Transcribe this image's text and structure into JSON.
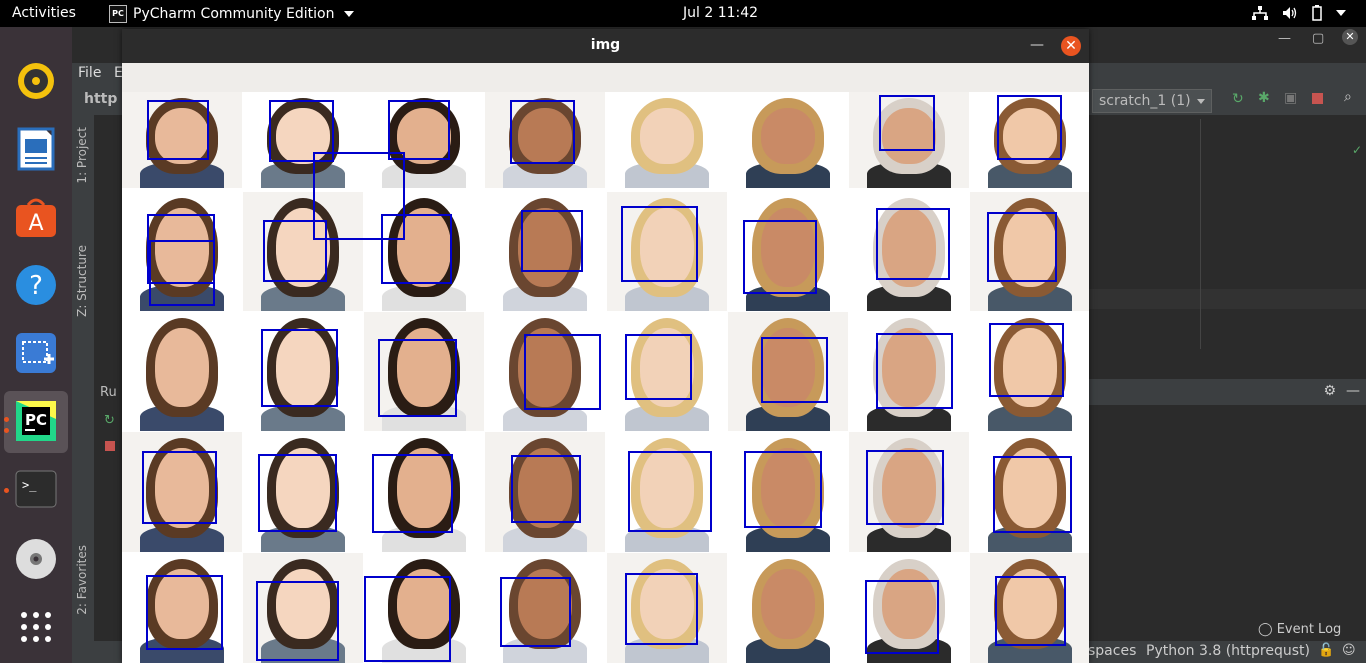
{
  "topbar": {
    "activities": "Activities",
    "app_name": "PyCharm Community Edition",
    "app_icon": "PC",
    "clock": "Jul 2  11:42"
  },
  "dock": {
    "items": [
      "rhythmbox-icon",
      "libreoffice-writer-icon",
      "ubuntu-software-icon",
      "help-icon",
      "screenshot-icon",
      "pycharm-icon",
      "terminal-icon",
      "dvd-icon",
      "app-grid-icon"
    ]
  },
  "ide": {
    "menu_file": "File",
    "menu_edit": "E",
    "project_fragment": "http",
    "run_config": "scratch_1 (1)",
    "left_tabs": {
      "project": "1: Project",
      "structure": "Z: Structure",
      "favorites": "2: Favorites"
    },
    "run_label": "Ru",
    "event_log": "Event Log",
    "status_spaces": "spaces",
    "status_interpreter": "Python 3.8 (httprequst)"
  },
  "imgwin": {
    "title": "img",
    "minimize": "—",
    "close": "✕"
  },
  "colors": {
    "box": "#0000cc",
    "ubuntu_orange": "#e95420"
  },
  "grid": {
    "rows": 5,
    "cols": 8,
    "detections_per_row": [
      8,
      9,
      7,
      8,
      8
    ]
  }
}
